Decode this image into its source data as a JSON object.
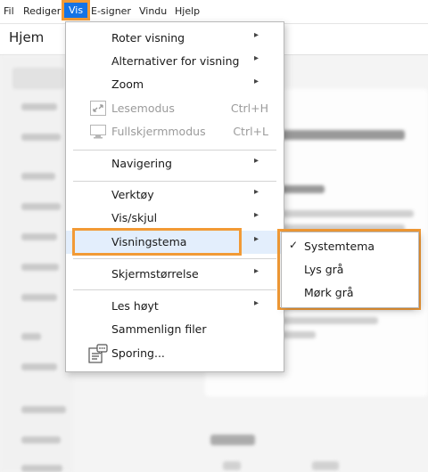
{
  "menubar": {
    "items": [
      "Fil",
      "Rediger",
      "Vis",
      "E-signer",
      "Vindu",
      "Hjelp"
    ],
    "active_index": 2
  },
  "tab": {
    "label": "Hjem"
  },
  "vis_menu": {
    "items": [
      {
        "label": "Roter visning",
        "submenu": true
      },
      {
        "label": "Alternativer for visning",
        "submenu": true
      },
      {
        "label": "Zoom",
        "submenu": true
      },
      {
        "label": "Lesemodus",
        "shortcut": "Ctrl+H",
        "disabled": true,
        "icon": "read-mode-icon"
      },
      {
        "label": "Fullskjermmodus",
        "shortcut": "Ctrl+L",
        "disabled": true,
        "icon": "full-screen-icon"
      },
      {
        "label": "Navigering",
        "submenu": true
      },
      {
        "label": "Verktøy",
        "submenu": true
      },
      {
        "label": "Vis/skjul",
        "submenu": true
      },
      {
        "label": "Visningstema",
        "submenu": true,
        "highlighted": true
      },
      {
        "label": "Skjermstørrelse",
        "submenu": true
      },
      {
        "label": "Les høyt",
        "submenu": true
      },
      {
        "label": "Sammenlign filer"
      },
      {
        "label": "Sporing...",
        "icon": "tracker-icon"
      }
    ],
    "submenu_arrow": "▸"
  },
  "theme_submenu": {
    "items": [
      {
        "label": "Systemtema",
        "checked": true
      },
      {
        "label": "Lys grå"
      },
      {
        "label": "Mørk grå"
      }
    ],
    "check_mark": "✓"
  },
  "colors": {
    "accent": "#1473e6",
    "highlight_outline": "#f29a35",
    "menu_hover": "#e3eefc"
  }
}
